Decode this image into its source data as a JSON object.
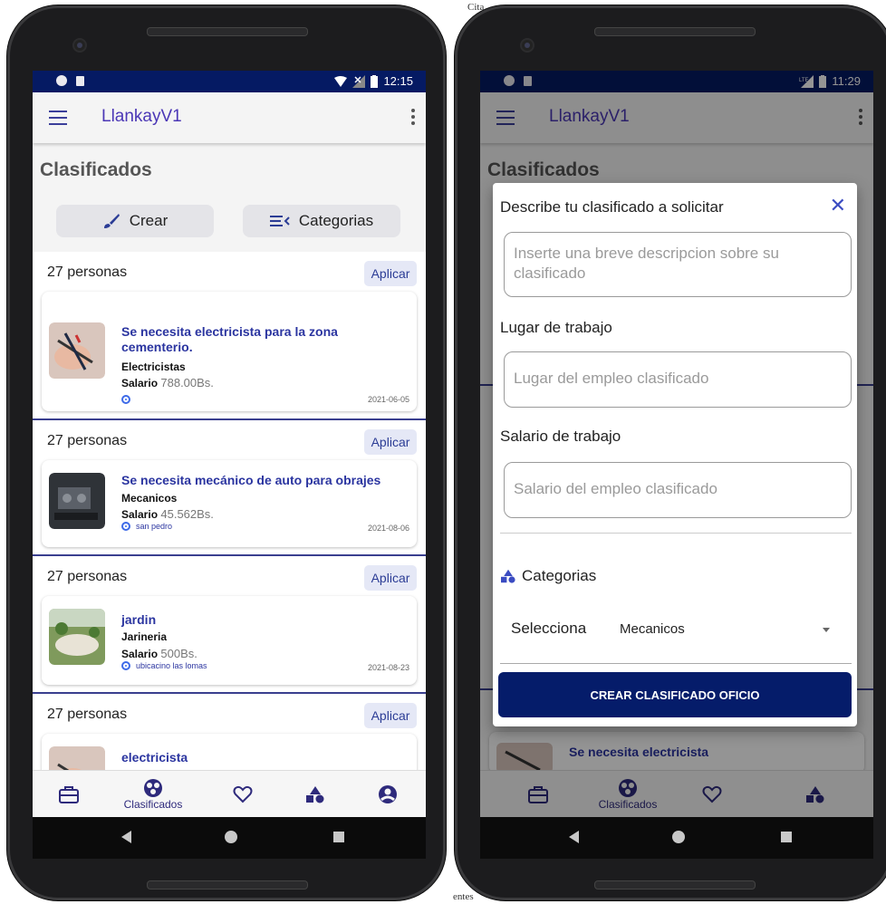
{
  "background_fragments": [
    "Cita",
    "entes"
  ],
  "phones": [
    {
      "status_time": "12:15",
      "app_title": "LlankayV1",
      "page_title": "Clasificados",
      "buttons": {
        "create": "Crear",
        "categories": "Categorias"
      },
      "listings": [
        {
          "people": "27 personas",
          "apply": "Aplicar",
          "title": "Se necesita electricista para la zona cementerio.",
          "category": "Electricistas",
          "salary_label": "Salario",
          "salary_value": "788.00Bs.",
          "location": "",
          "date": "2021-06-05"
        },
        {
          "people": "27 personas",
          "apply": "Aplicar",
          "title": "Se necesita mecánico de auto para obrajes",
          "category": "Mecanicos",
          "salary_label": "Salario",
          "salary_value": "45.562Bs.",
          "location": "san pedro",
          "date": "2021-08-06"
        },
        {
          "people": "27 personas",
          "apply": "Aplicar",
          "title": "jardin",
          "category": "Jarineria",
          "salary_label": "Salario",
          "salary_value": "500Bs.",
          "location": "ubicacino las lomas",
          "date": "2021-08-23"
        },
        {
          "people": "27 personas",
          "apply": "Aplicar",
          "title": "electricista",
          "category": "",
          "salary_label": "",
          "salary_value": "",
          "location": "",
          "date": ""
        }
      ],
      "bottom_nav": {
        "active_label": "Clasificados"
      }
    },
    {
      "status_time": "11:29",
      "app_title": "LlankayV1",
      "page_title": "Clasificados",
      "behind_card_title": "Se necesita electricista",
      "bottom_nav": {
        "active_label": "Clasificados"
      },
      "dialog": {
        "title": "Describe tu clasificado a solicitar",
        "description_placeholder": "Inserte una breve descripcion sobre su clasificado",
        "workplace_label": "Lugar de trabajo",
        "workplace_placeholder": "Lugar del empleo clasificado",
        "salary_label": "Salario de trabajo",
        "salary_placeholder": "Salario del empleo clasificado",
        "categories_label": "Categorias",
        "select_label": "Selecciona",
        "select_value": "Mecanicos",
        "submit_label": "CREAR CLASIFICADO OFICIO"
      }
    }
  ],
  "colors": {
    "primary": "#051a63",
    "accent": "#4b37b6",
    "link": "#2b35a0"
  }
}
